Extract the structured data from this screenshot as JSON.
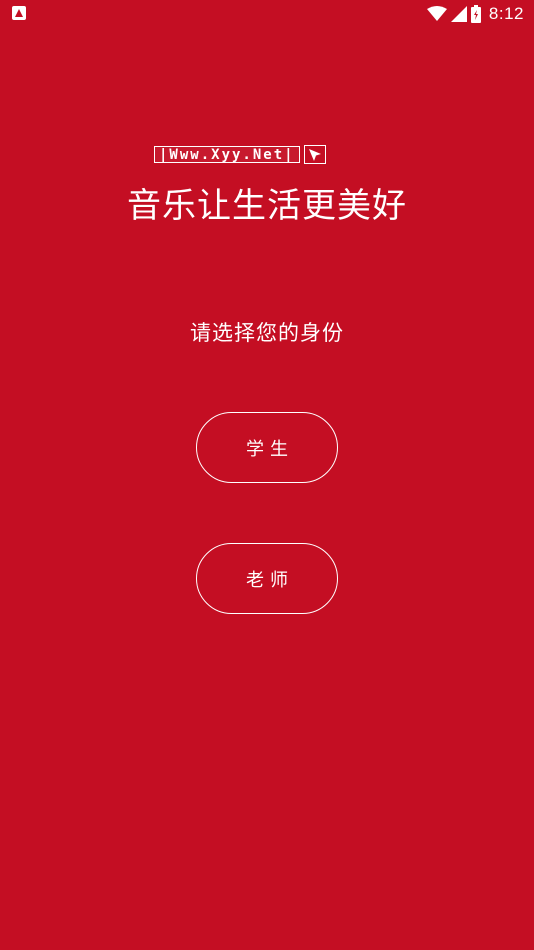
{
  "status_bar": {
    "time": "8:12",
    "icons": [
      "app-notification-icon",
      "wifi-icon",
      "signal-icon",
      "battery-icon"
    ]
  },
  "watermark": {
    "text": "|Www.Xyy.Net|"
  },
  "slogan": "音乐让生活更美好",
  "prompt": "请选择您的身份",
  "roles": {
    "student": "学生",
    "teacher": "老师"
  },
  "colors": {
    "background": "#c40e23",
    "foreground": "#ffffff"
  }
}
